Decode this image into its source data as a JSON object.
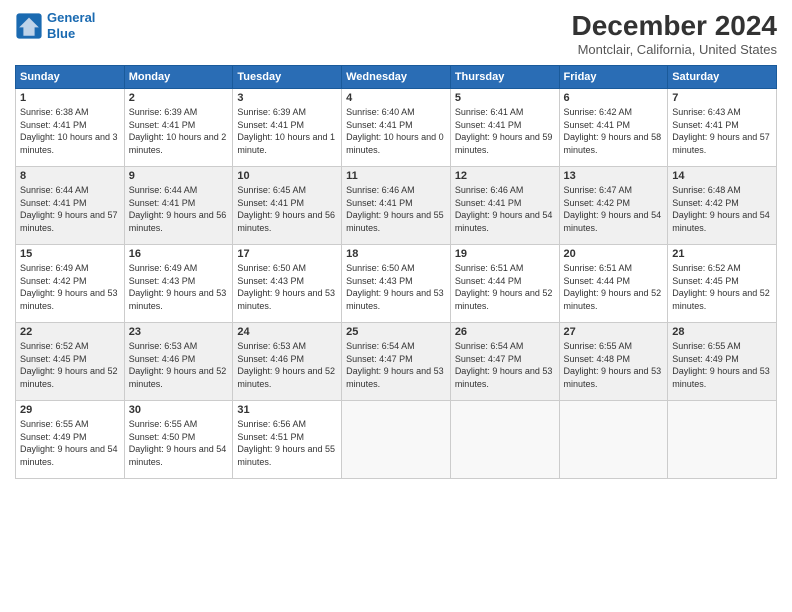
{
  "header": {
    "logo_line1": "General",
    "logo_line2": "Blue",
    "month_title": "December 2024",
    "location": "Montclair, California, United States"
  },
  "days_of_week": [
    "Sunday",
    "Monday",
    "Tuesday",
    "Wednesday",
    "Thursday",
    "Friday",
    "Saturday"
  ],
  "weeks": [
    [
      {
        "day": "1",
        "sunrise": "6:38 AM",
        "sunset": "4:41 PM",
        "daylight": "10 hours and 3 minutes."
      },
      {
        "day": "2",
        "sunrise": "6:39 AM",
        "sunset": "4:41 PM",
        "daylight": "10 hours and 2 minutes."
      },
      {
        "day": "3",
        "sunrise": "6:39 AM",
        "sunset": "4:41 PM",
        "daylight": "10 hours and 1 minute."
      },
      {
        "day": "4",
        "sunrise": "6:40 AM",
        "sunset": "4:41 PM",
        "daylight": "10 hours and 0 minutes."
      },
      {
        "day": "5",
        "sunrise": "6:41 AM",
        "sunset": "4:41 PM",
        "daylight": "9 hours and 59 minutes."
      },
      {
        "day": "6",
        "sunrise": "6:42 AM",
        "sunset": "4:41 PM",
        "daylight": "9 hours and 58 minutes."
      },
      {
        "day": "7",
        "sunrise": "6:43 AM",
        "sunset": "4:41 PM",
        "daylight": "9 hours and 57 minutes."
      }
    ],
    [
      {
        "day": "8",
        "sunrise": "6:44 AM",
        "sunset": "4:41 PM",
        "daylight": "9 hours and 57 minutes."
      },
      {
        "day": "9",
        "sunrise": "6:44 AM",
        "sunset": "4:41 PM",
        "daylight": "9 hours and 56 minutes."
      },
      {
        "day": "10",
        "sunrise": "6:45 AM",
        "sunset": "4:41 PM",
        "daylight": "9 hours and 56 minutes."
      },
      {
        "day": "11",
        "sunrise": "6:46 AM",
        "sunset": "4:41 PM",
        "daylight": "9 hours and 55 minutes."
      },
      {
        "day": "12",
        "sunrise": "6:46 AM",
        "sunset": "4:41 PM",
        "daylight": "9 hours and 54 minutes."
      },
      {
        "day": "13",
        "sunrise": "6:47 AM",
        "sunset": "4:42 PM",
        "daylight": "9 hours and 54 minutes."
      },
      {
        "day": "14",
        "sunrise": "6:48 AM",
        "sunset": "4:42 PM",
        "daylight": "9 hours and 54 minutes."
      }
    ],
    [
      {
        "day": "15",
        "sunrise": "6:49 AM",
        "sunset": "4:42 PM",
        "daylight": "9 hours and 53 minutes."
      },
      {
        "day": "16",
        "sunrise": "6:49 AM",
        "sunset": "4:43 PM",
        "daylight": "9 hours and 53 minutes."
      },
      {
        "day": "17",
        "sunrise": "6:50 AM",
        "sunset": "4:43 PM",
        "daylight": "9 hours and 53 minutes."
      },
      {
        "day": "18",
        "sunrise": "6:50 AM",
        "sunset": "4:43 PM",
        "daylight": "9 hours and 53 minutes."
      },
      {
        "day": "19",
        "sunrise": "6:51 AM",
        "sunset": "4:44 PM",
        "daylight": "9 hours and 52 minutes."
      },
      {
        "day": "20",
        "sunrise": "6:51 AM",
        "sunset": "4:44 PM",
        "daylight": "9 hours and 52 minutes."
      },
      {
        "day": "21",
        "sunrise": "6:52 AM",
        "sunset": "4:45 PM",
        "daylight": "9 hours and 52 minutes."
      }
    ],
    [
      {
        "day": "22",
        "sunrise": "6:52 AM",
        "sunset": "4:45 PM",
        "daylight": "9 hours and 52 minutes."
      },
      {
        "day": "23",
        "sunrise": "6:53 AM",
        "sunset": "4:46 PM",
        "daylight": "9 hours and 52 minutes."
      },
      {
        "day": "24",
        "sunrise": "6:53 AM",
        "sunset": "4:46 PM",
        "daylight": "9 hours and 52 minutes."
      },
      {
        "day": "25",
        "sunrise": "6:54 AM",
        "sunset": "4:47 PM",
        "daylight": "9 hours and 53 minutes."
      },
      {
        "day": "26",
        "sunrise": "6:54 AM",
        "sunset": "4:47 PM",
        "daylight": "9 hours and 53 minutes."
      },
      {
        "day": "27",
        "sunrise": "6:55 AM",
        "sunset": "4:48 PM",
        "daylight": "9 hours and 53 minutes."
      },
      {
        "day": "28",
        "sunrise": "6:55 AM",
        "sunset": "4:49 PM",
        "daylight": "9 hours and 53 minutes."
      }
    ],
    [
      {
        "day": "29",
        "sunrise": "6:55 AM",
        "sunset": "4:49 PM",
        "daylight": "9 hours and 54 minutes."
      },
      {
        "day": "30",
        "sunrise": "6:55 AM",
        "sunset": "4:50 PM",
        "daylight": "9 hours and 54 minutes."
      },
      {
        "day": "31",
        "sunrise": "6:56 AM",
        "sunset": "4:51 PM",
        "daylight": "9 hours and 55 minutes."
      },
      null,
      null,
      null,
      null
    ]
  ]
}
